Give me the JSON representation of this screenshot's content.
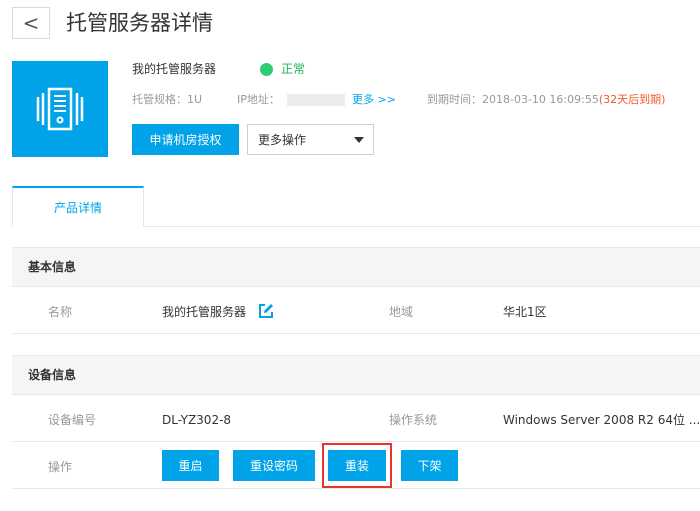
{
  "header": {
    "back_glyph": "<",
    "title": "托管服务器详情"
  },
  "summary": {
    "icon": "server-rack-icon",
    "name": "我的托管服务器",
    "status": {
      "label": "正常",
      "color": "#2ecc71"
    },
    "spec": "托管规格：1U",
    "ip_label": "IP地址：",
    "more_link": "更多 >>",
    "expire": "到期时间：2018-03-10 16:09:55",
    "expire_warning": "(32天后到期)",
    "apply_button": "申请机房授权",
    "more_ops": {
      "selected": "更多操作"
    }
  },
  "tabs": [
    {
      "label": "产品详情",
      "active": true
    }
  ],
  "basic_info": {
    "heading": "基本信息",
    "name_label": "名称",
    "name_value": "我的托管服务器",
    "region_label": "地域",
    "region_value": "华北1区"
  },
  "device_info": {
    "heading": "设备信息",
    "device_id_label": "设备编号",
    "device_id_value": "DL-YZ302-8",
    "os_label": "操作系统",
    "os_value": "Windows Server 2008 R2 64位 ...",
    "actions_label": "操作",
    "actions": {
      "restart": "重启",
      "reset_password": "重设密码",
      "reinstall": "重装",
      "unshelve": "下架"
    }
  },
  "colors": {
    "accent": "#00a2e8",
    "warning": "#f05a28",
    "highlight": "#e8342c"
  }
}
